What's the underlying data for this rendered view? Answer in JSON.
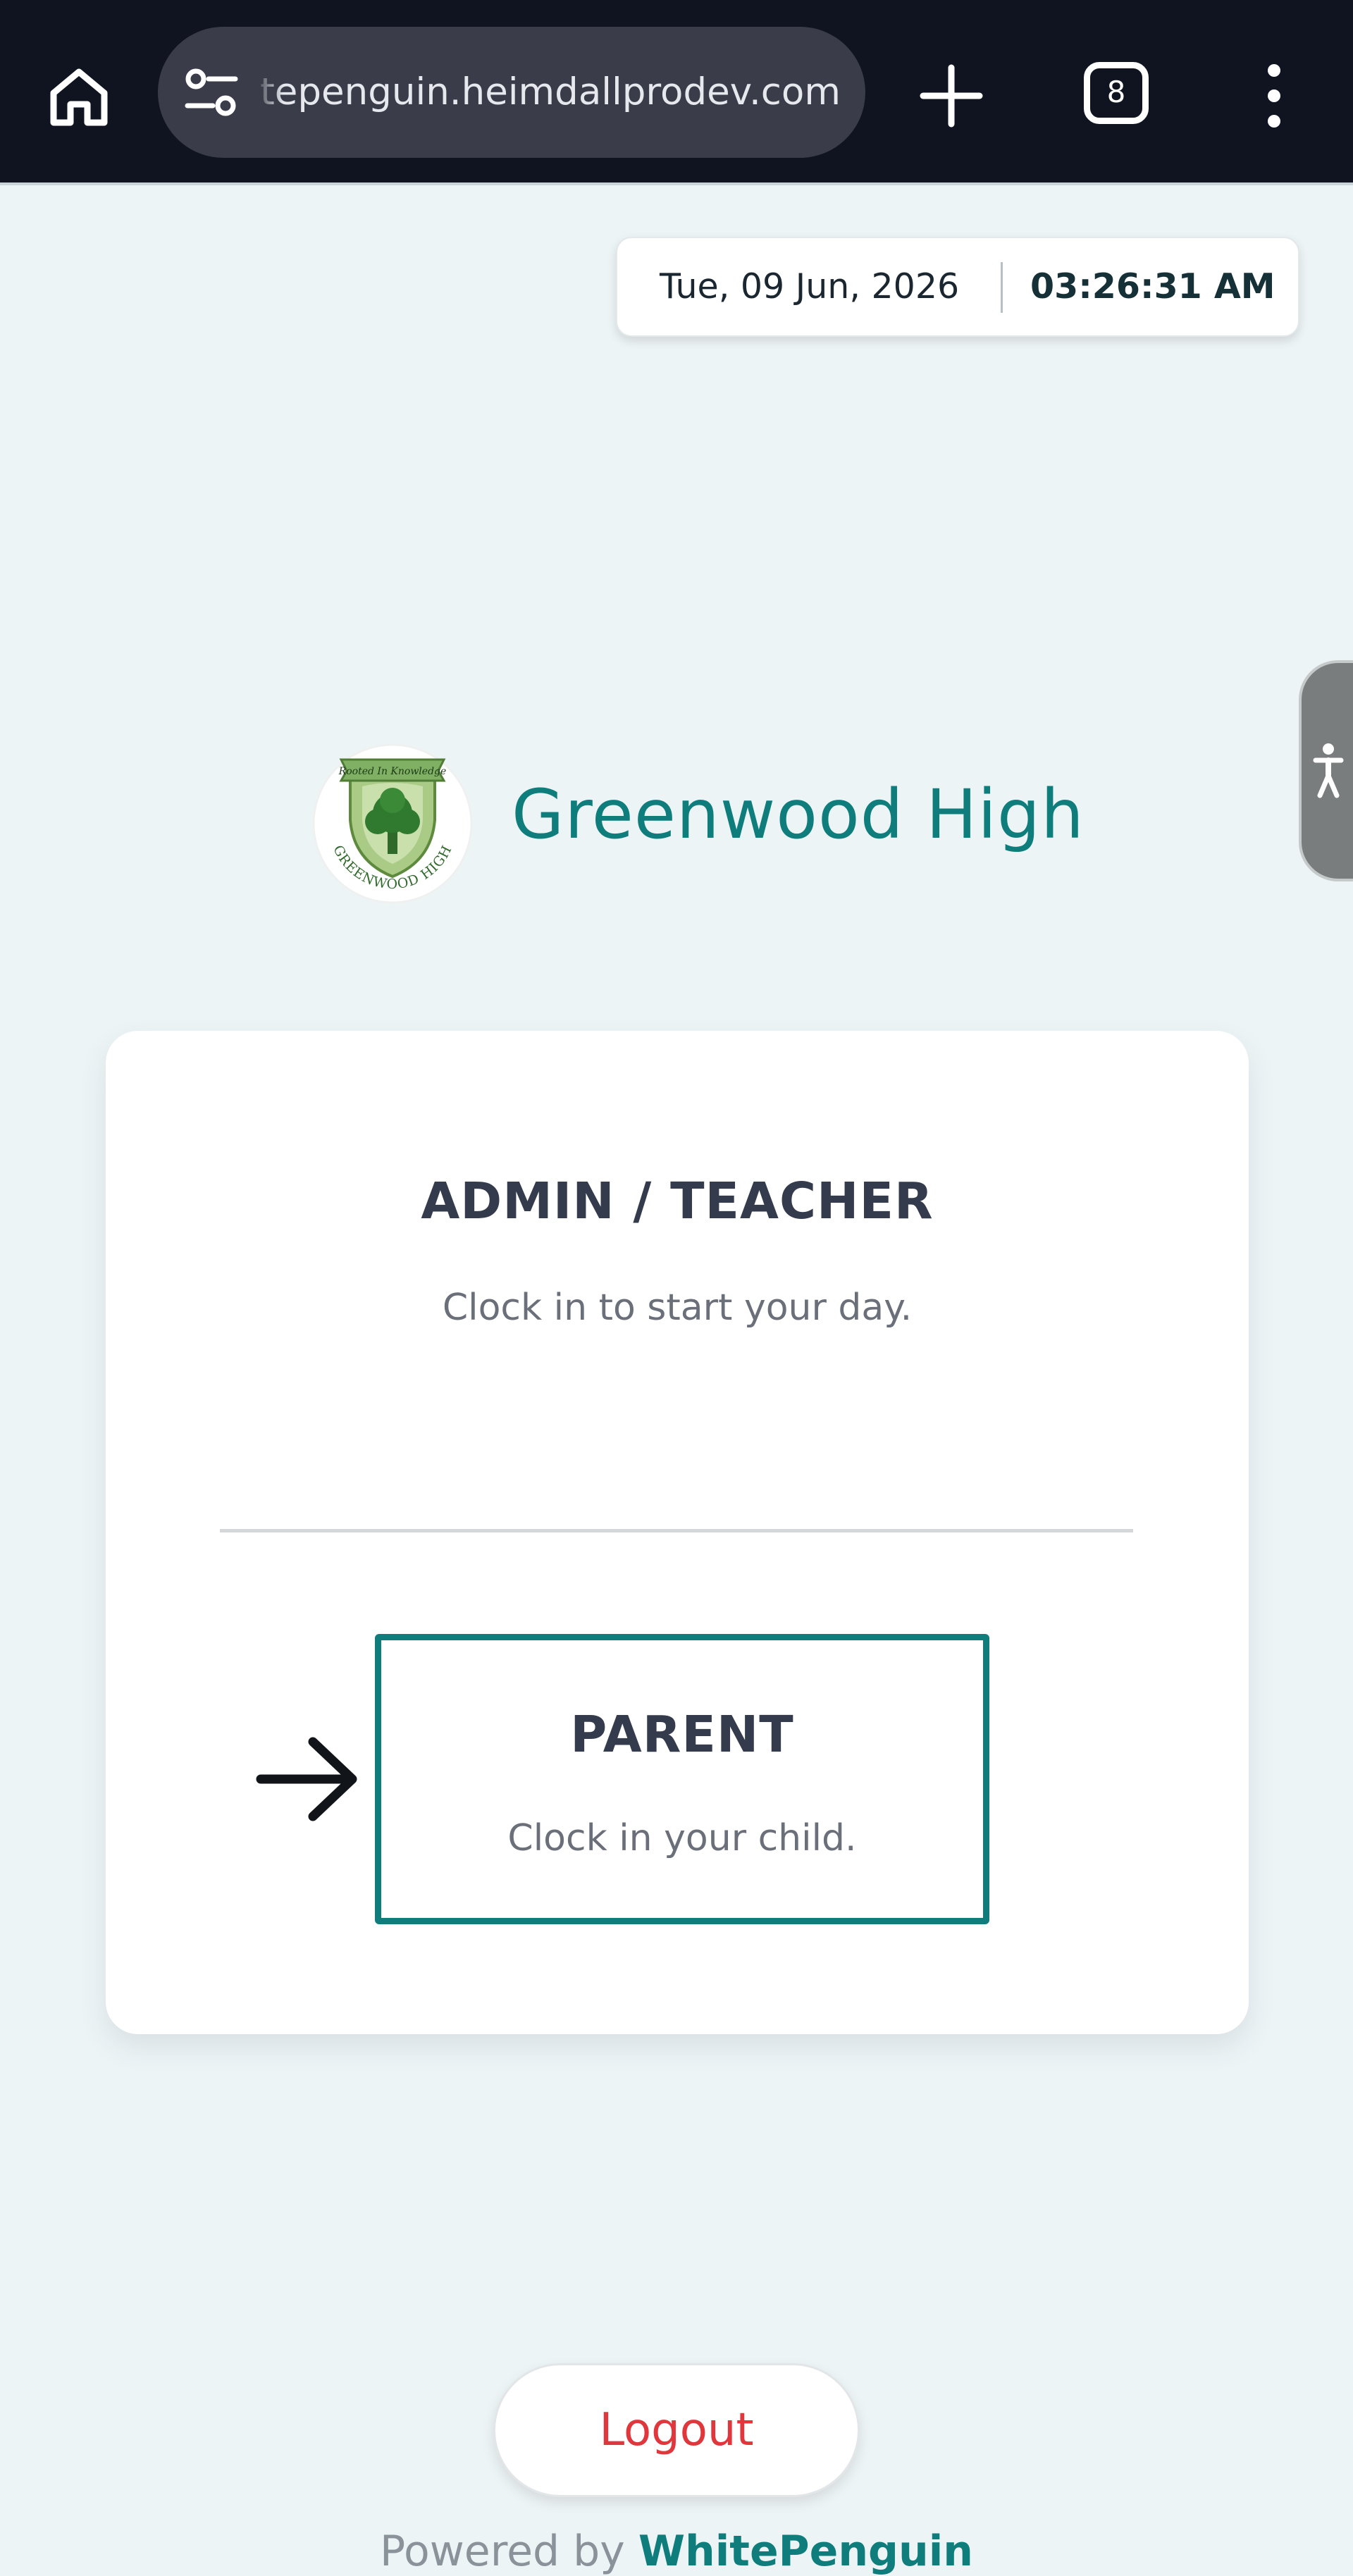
{
  "browser": {
    "url_text": "tepenguin.heimdallprodev.com",
    "tab_count": "8",
    "icons": [
      "home-icon",
      "site-settings-icon",
      "new-tab-icon",
      "tab-switcher-icon",
      "more-menu-icon"
    ]
  },
  "datetime": {
    "date": "Tue, 09 Jun, 2026",
    "time": "03:26:31 AM"
  },
  "accessibility": {
    "icon": "accessibility-icon"
  },
  "school": {
    "name": "Greenwood High",
    "logo_ribbon": "Rooted In Knowledge",
    "logo_ring_text": "GREENWOOD HIGH"
  },
  "roles": {
    "admin": {
      "title": "ADMIN / TEACHER",
      "subtitle": "Clock in to start your day."
    },
    "parent": {
      "title": "PARENT",
      "subtitle": "Clock in your child."
    }
  },
  "footer": {
    "logout_label": "Logout",
    "powered_prefix": "Powered by",
    "powered_brand": "WhitePenguin"
  },
  "colors": {
    "accent": "#0e7d7c",
    "logout": "#e0363c",
    "background": "#edf4f6"
  }
}
